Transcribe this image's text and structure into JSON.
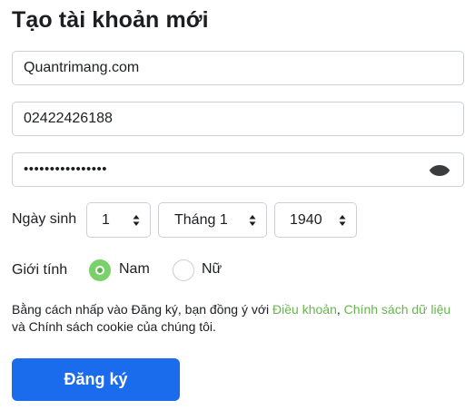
{
  "form": {
    "title": "Tạo tài khoản mới",
    "name_value": "Quantrimang.com",
    "phone_value": "02422426188",
    "password_mask": "••••••••••••••••",
    "birthday_label": "Ngày sinh",
    "day_value": "1",
    "month_value": "Tháng 1",
    "year_value": "1940",
    "gender_label": "Giới tính",
    "gender_options": [
      {
        "label": "Nam",
        "selected": true
      },
      {
        "label": "Nữ",
        "selected": false
      }
    ],
    "terms": {
      "prefix": "Bằng cách nhấp vào Đăng ký, bạn đồng ý với ",
      "link_terms": "Điều khoản",
      "comma": ", ",
      "link_data_policy": "Chính sách dữ liệu",
      "suffix": " và Chính sách cookie của chúng tôi."
    },
    "submit_label": "Đăng ký"
  },
  "colors": {
    "accent_button": "#1b6ced",
    "link_green": "#67b54e",
    "radio_green": "#7ad06a",
    "border": "#ccd0d5",
    "text": "#1c1e21"
  },
  "icons": {
    "password_toggle": "eye-icon",
    "select_arrows": "sort-arrows-icon"
  }
}
